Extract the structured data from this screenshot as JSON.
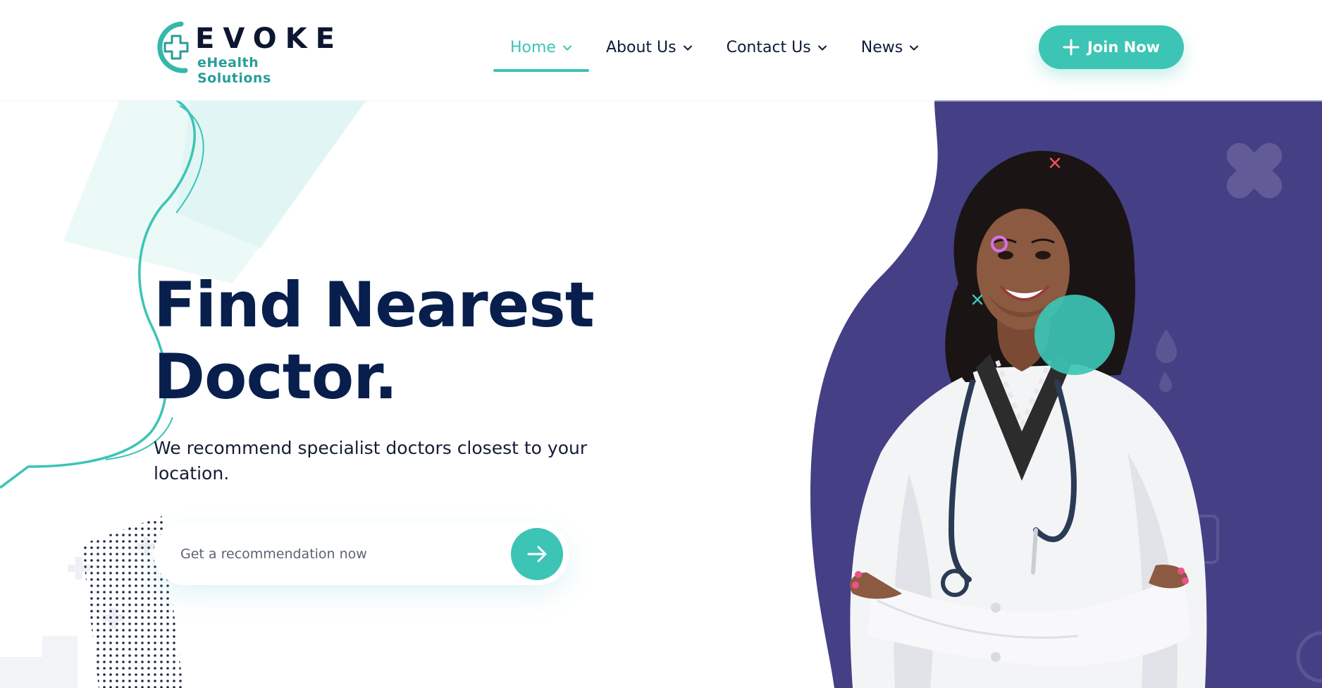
{
  "brand": {
    "name": "EVOKE",
    "tagline": "eHealth Solutions"
  },
  "nav": {
    "items": [
      {
        "label": "Home",
        "active": true
      },
      {
        "label": "About Us",
        "active": false
      },
      {
        "label": "Contact Us",
        "active": false
      },
      {
        "label": "News",
        "active": false
      }
    ]
  },
  "header": {
    "join_label": "Join Now"
  },
  "hero": {
    "headline_line1": "Find Nearest",
    "headline_line2": "Doctor.",
    "subtext": "We recommend specialist doctors closest to your location.",
    "search_placeholder": "Get a recommendation now"
  },
  "colors": {
    "accent": "#3cc4b5",
    "headline": "#081f4e",
    "hero_panel": "#453f85",
    "text": "#0d1b3a"
  },
  "icons": {
    "nav_dropdown": "chevron-down-icon",
    "join": "plus-icon",
    "search_submit": "arrow-right-icon"
  }
}
